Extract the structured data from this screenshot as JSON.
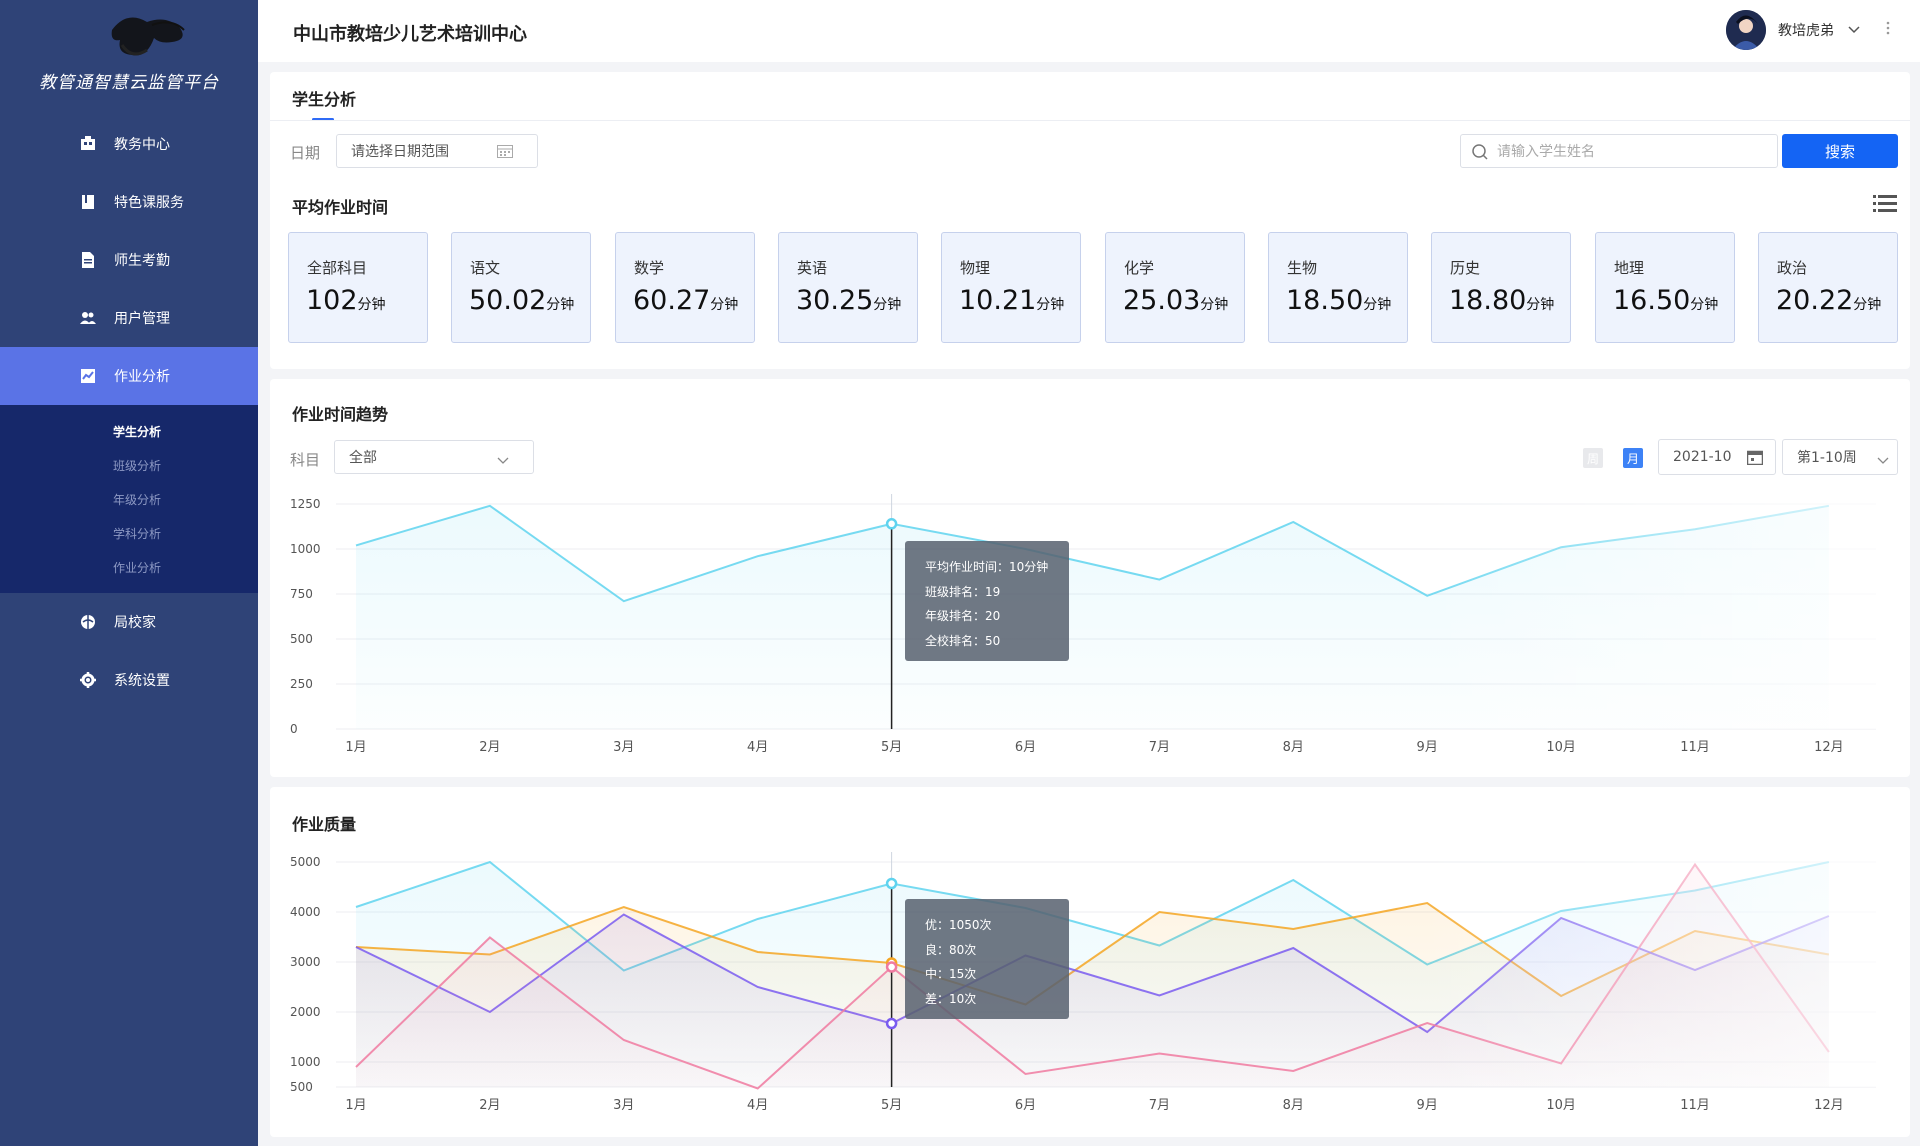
{
  "sidebar": {
    "platform_name": "教管通智慧云监管平台",
    "nav": [
      {
        "label": "教务中心",
        "icon": "building-icon"
      },
      {
        "label": "特色课服务",
        "icon": "book-icon"
      },
      {
        "label": "师生考勤",
        "icon": "document-icon"
      },
      {
        "label": "用户管理",
        "icon": "users-icon"
      },
      {
        "label": "作业分析",
        "icon": "chart-icon"
      },
      {
        "label": "局校家",
        "icon": "globe-icon"
      },
      {
        "label": "系统设置",
        "icon": "gear-icon"
      }
    ],
    "active_nav": "作业分析",
    "sub_items": [
      "学生分析",
      "班级分析",
      "年级分析",
      "学科分析",
      "作业分析"
    ],
    "active_sub": "学生分析"
  },
  "header": {
    "org_title": "中山市教培少儿艺术培训中心",
    "user_name": "教培虎弟"
  },
  "tab": {
    "label": "学生分析"
  },
  "filters": {
    "date_label": "日期",
    "date_placeholder": "请选择日期范围",
    "search_placeholder": "请输入学生姓名",
    "search_button": "搜索"
  },
  "avg_time": {
    "title": "平均作业时间",
    "unit": "分钟",
    "cards": [
      {
        "subject": "全部科目",
        "value": "102"
      },
      {
        "subject": "语文",
        "value": "50.02"
      },
      {
        "subject": "数学",
        "value": "60.27"
      },
      {
        "subject": "英语",
        "value": "30.25"
      },
      {
        "subject": "物理",
        "value": "10.21"
      },
      {
        "subject": "化学",
        "value": "25.03"
      },
      {
        "subject": "生物",
        "value": "18.50"
      },
      {
        "subject": "历史",
        "value": "18.80"
      },
      {
        "subject": "地理",
        "value": "16.50"
      },
      {
        "subject": "政治",
        "value": "20.22"
      }
    ]
  },
  "trend": {
    "title": "作业时间趋势",
    "subject_label": "科目",
    "subject_value": "全部",
    "toggle_week": "周",
    "toggle_month": "月",
    "month_value": "2021-10",
    "week_range": "第1-10周",
    "tooltip": [
      "平均作业时间：10分钟",
      "班级排名：19",
      "年级排名：20",
      "全校排名：50"
    ]
  },
  "quality": {
    "title": "作业质量",
    "tooltip": [
      "优：1050次",
      "良：80次",
      "中：15次",
      "差：10次"
    ]
  },
  "colors": {
    "sidebar_bg": "#2f4377",
    "primary": "#1464f4",
    "cyan": "#5fd3ef",
    "orange": "#f5a623",
    "purple": "#7a5cf0",
    "pink": "#f07aa0"
  },
  "chart_data": [
    {
      "type": "area",
      "categories": [
        "1月",
        "2月",
        "3月",
        "4月",
        "5月",
        "6月",
        "7月",
        "8月",
        "9月",
        "10月",
        "11月",
        "12月"
      ],
      "ylim": [
        0,
        1250
      ],
      "yticks": [
        0,
        250,
        500,
        750,
        1000,
        1250
      ],
      "grid": true,
      "series": [
        {
          "values": [
            1020,
            1240,
            710,
            960,
            1140,
            1000,
            830,
            1150,
            740,
            1010,
            1110,
            1240
          ]
        }
      ],
      "highlight_index": 4
    },
    {
      "type": "area",
      "categories": [
        "1月",
        "2月",
        "3月",
        "4月",
        "5月",
        "6月",
        "7月",
        "8月",
        "9月",
        "10月",
        "11月",
        "12月"
      ],
      "ylim": [
        500,
        5000
      ],
      "yticks": [
        500,
        1000,
        2000,
        3000,
        4000,
        5000
      ],
      "grid": true,
      "series": [
        {
          "values": [
            4100,
            5000,
            2830,
            3860,
            4570,
            4080,
            3330,
            4640,
            2950,
            4020,
            4430,
            5000
          ]
        },
        {
          "values": [
            3300,
            3150,
            4100,
            3200,
            2980,
            2150,
            4000,
            3660,
            4180,
            2320,
            3620,
            3150
          ]
        },
        {
          "values": [
            3300,
            2000,
            3950,
            2500,
            1770,
            3130,
            2330,
            3280,
            1600,
            3880,
            2840,
            3920
          ]
        },
        {
          "values": [
            900,
            3490,
            1440,
            470,
            2900,
            760,
            1170,
            820,
            1780,
            970,
            4950,
            1200
          ]
        }
      ],
      "highlight_index": 4
    }
  ]
}
